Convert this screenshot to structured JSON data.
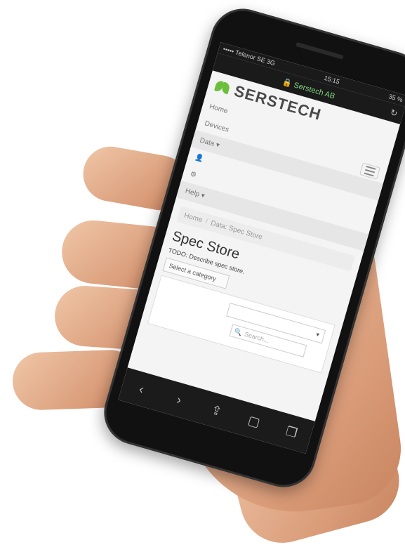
{
  "status": {
    "carrier": "••••• Telenor SE  3G",
    "time": "15:15",
    "battery": "35 %"
  },
  "browser": {
    "url": "Serstech AB",
    "reload_icon": "reload-icon"
  },
  "brand": {
    "name": "SERSTECH",
    "logo_color": "#6cbf3d"
  },
  "nav": {
    "items": [
      {
        "label": "Home"
      },
      {
        "label": "Devices"
      },
      {
        "label": "Data ▾"
      },
      {
        "label": ""
      },
      {
        "label": ""
      },
      {
        "label": "Help ▾"
      }
    ]
  },
  "breadcrumb": {
    "home": "Home",
    "current": "Data: Spec Store"
  },
  "page": {
    "title": "Spec Store",
    "description": "TODO: Describe spec store.",
    "select_label": "Select a category",
    "search_placeholder": "Search..."
  },
  "toolbar": {
    "icons": [
      "back-icon",
      "forward-icon",
      "share-icon",
      "bookmarks-icon",
      "tabs-icon"
    ]
  }
}
